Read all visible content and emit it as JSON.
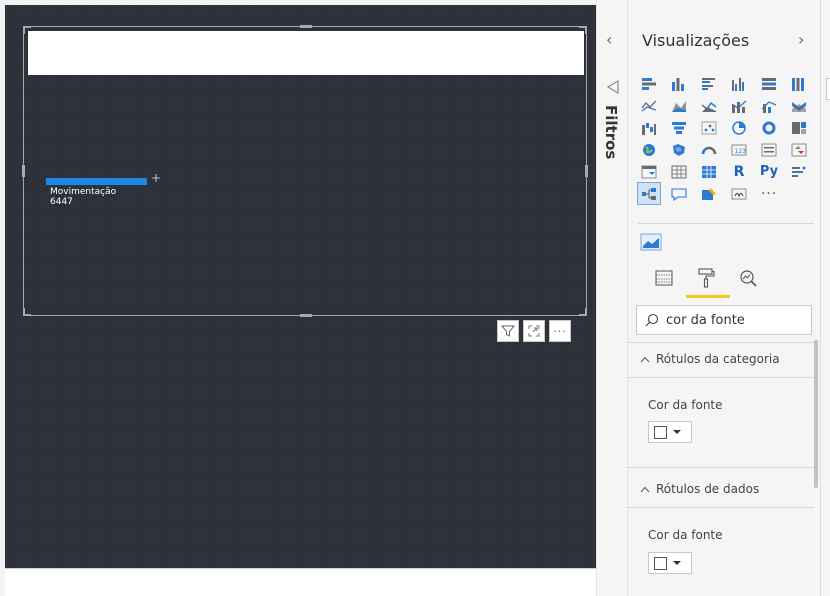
{
  "canvas": {
    "visual": {
      "category_label": "Movimentação",
      "value_label": "6447",
      "bar_color": "#1e88e5"
    }
  },
  "filters": {
    "label": "Filtros"
  },
  "visualizations": {
    "title": "Visualizações",
    "more_label": "···",
    "icons": [
      "stacked-bar-icon",
      "stacked-column-icon",
      "clustered-bar-icon",
      "clustered-column-icon",
      "100-bar-icon",
      "100-column-icon",
      "line-chart-icon",
      "area-chart-icon",
      "stacked-area-icon",
      "line-column-icon",
      "line-clustered-icon",
      "ribbon-chart-icon",
      "waterfall-icon",
      "funnel-icon",
      "scatter-icon",
      "pie-chart-icon",
      "donut-chart-icon",
      "treemap-icon",
      "map-icon",
      "filled-map-icon",
      "gauge-icon",
      "card-icon",
      "multi-row-card-icon",
      "kpi-icon",
      "slicer-icon",
      "table-icon",
      "matrix-icon",
      "r-visual-icon",
      "python-visual-icon",
      "key-influencers-icon",
      "decomposition-tree-icon",
      "qa-icon",
      "smart-narrative-icon",
      "paginated-report-icon"
    ],
    "accent_color": "#f2c811"
  },
  "format_pane": {
    "search_value": "cor da fonte",
    "sections": [
      {
        "title": "Rótulos da categoria",
        "property": "Cor da fonte"
      },
      {
        "title": "Rótulos de dados",
        "property": "Cor da fonte"
      }
    ]
  }
}
